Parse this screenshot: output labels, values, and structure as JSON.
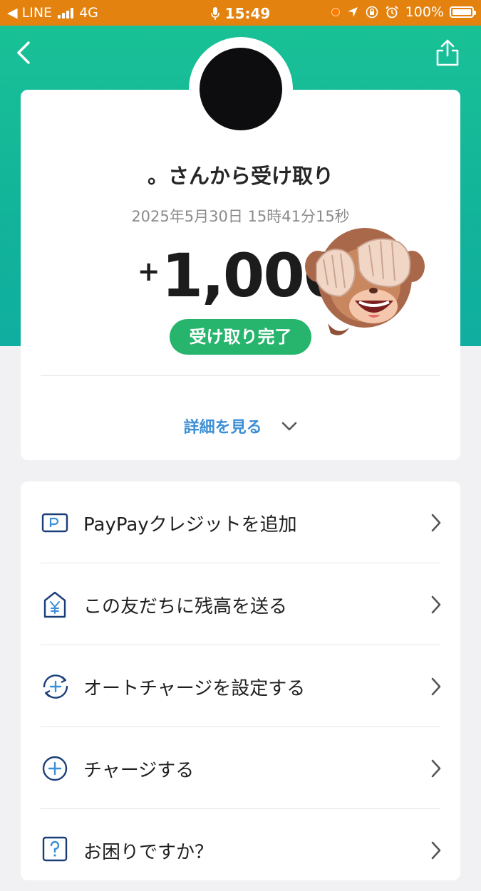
{
  "status_bar": {
    "back_app": "◀ LINE",
    "network": "4G",
    "time": "15:49",
    "battery": "100%"
  },
  "header": {
    "background_color": "#19c196",
    "back_icon": "chevron-left-icon",
    "share_icon": "share-icon"
  },
  "summary": {
    "title": "。さんから受け取り",
    "datetime": "2025年5月30日 15時41分15秒",
    "amount_sign": "+",
    "amount": "1,000",
    "status": "受け取り完了",
    "status_color": "#27b46c",
    "details_label": "詳細を見る"
  },
  "actions": [
    {
      "label": "PayPayクレジットを追加",
      "icon": "credit-card-icon"
    },
    {
      "label": "この友だちに残高を送る",
      "icon": "send-yen-icon"
    },
    {
      "label": "オートチャージを設定する",
      "icon": "auto-charge-icon"
    },
    {
      "label": "チャージする",
      "icon": "charge-plus-icon"
    },
    {
      "label": "お困りですか？",
      "icon": "help-icon"
    }
  ]
}
